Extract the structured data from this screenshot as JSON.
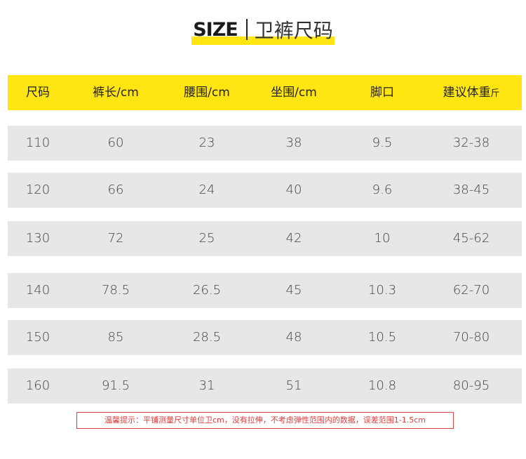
{
  "title": {
    "size": "SIZE",
    "subtitle": "卫裤尺码"
  },
  "colors": {
    "accent": "#ffe512",
    "row_bg": "#e7e7e7",
    "note_red": "#e03b3b"
  },
  "table": {
    "headers": [
      "尺码",
      "裤长/cm",
      "腰围/cm",
      "坐围/cm",
      "脚口",
      "建议体重",
      "斤"
    ],
    "rows": [
      [
        "110",
        "60",
        "23",
        "38",
        "9.5",
        "32-38"
      ],
      [
        "120",
        "66",
        "24",
        "40",
        "9.6",
        "38-45"
      ],
      [
        "130",
        "72",
        "25",
        "42",
        "10",
        "45-62"
      ],
      [
        "140",
        "78.5",
        "26.5",
        "45",
        "10.3",
        "62-70"
      ],
      [
        "150",
        "85",
        "28.5",
        "48",
        "10.5",
        "70-80"
      ],
      [
        "160",
        "91.5",
        "31",
        "51",
        "10.8",
        "80-95"
      ]
    ]
  },
  "note": "温馨提示：平铺测量尺寸单位卫cm，没有拉伸，不考虑弹性范围内的数据，误差范围1-1.5cm"
}
